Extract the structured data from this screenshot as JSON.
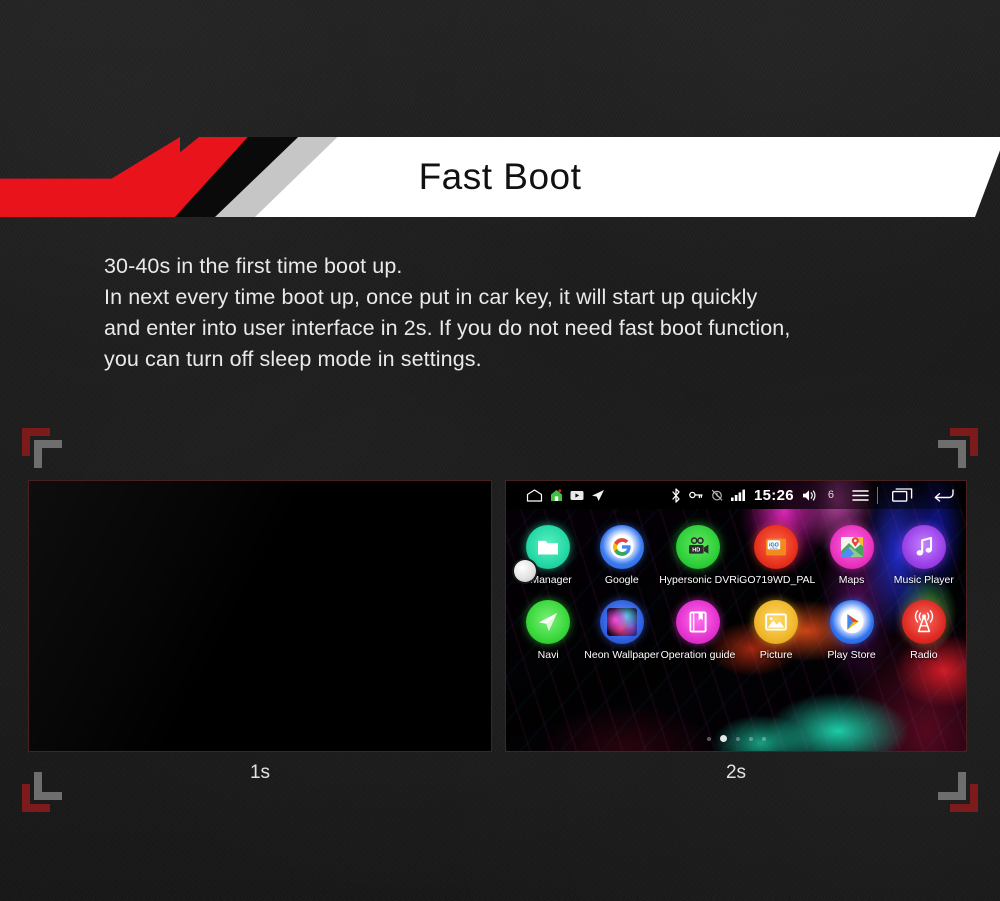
{
  "banner": {
    "title": "Fast Boot",
    "colors": {
      "red": "#e8131b",
      "black": "#0a0a0a",
      "gray": "#c6c6c6",
      "white": "#ffffff"
    }
  },
  "body_copy": {
    "line1": "30-40s in the first time boot up.",
    "line2": "In next every time boot up, once put in car key, it will start up quickly",
    "line3": "and enter into user interface in 2s. If you do not need fast boot function,",
    "line4": "you can turn off sleep mode in settings."
  },
  "screens": {
    "left": {
      "caption": "1s",
      "state": "black-screen"
    },
    "right": {
      "caption": "2s",
      "state": "android-home"
    }
  },
  "android": {
    "statusbar": {
      "left_icons": [
        "home-outline-icon",
        "green-house-icon",
        "video-icon",
        "navigation-arrow-icon"
      ],
      "right_icons": [
        "bluetooth-icon",
        "vpn-key-icon",
        "alarm-off-icon",
        "signal-bars-icon"
      ],
      "clock": "15:26",
      "volume_icon": "volume-icon",
      "notification_count": "6",
      "nav_icons": [
        "menu-icon",
        "recents-icon",
        "back-icon"
      ]
    },
    "apps": [
      {
        "label": "eManager",
        "icon": "folder-icon",
        "icon_class": "ic-emanager"
      },
      {
        "label": "Google",
        "icon": "google-g-icon",
        "icon_class": "ic-google"
      },
      {
        "label": "Hypersonic DVR",
        "icon": "video-camera-hd-icon",
        "icon_class": "ic-dvr"
      },
      {
        "label": "iGO719WD_PAL",
        "icon": "igo-primo-icon",
        "icon_class": "ic-igo"
      },
      {
        "label": "Maps",
        "icon": "google-maps-icon",
        "icon_class": "ic-maps"
      },
      {
        "label": "Music Player",
        "icon": "music-note-icon",
        "icon_class": "ic-music"
      },
      {
        "label": "Navi",
        "icon": "navigation-arrow-icon",
        "icon_class": "ic-navi"
      },
      {
        "label": "Neon Wallpaper",
        "icon": "neon-thumbnail-icon",
        "icon_class": "ic-neon"
      },
      {
        "label": "Operation guide",
        "icon": "book-icon",
        "icon_class": "ic-guide"
      },
      {
        "label": "Picture",
        "icon": "image-landscape-icon",
        "icon_class": "ic-picture"
      },
      {
        "label": "Play Store",
        "icon": "play-triangle-icon",
        "icon_class": "ic-play"
      },
      {
        "label": "Radio",
        "icon": "radio-tower-icon",
        "icon_class": "ic-radio"
      }
    ],
    "page_dots": {
      "count": 5,
      "active_index": 1
    }
  },
  "corner_markers": {
    "colors": {
      "red": "#7d1a1c",
      "gray": "#6e6e6e"
    },
    "positions": [
      "top-left",
      "top-right",
      "bottom-left",
      "bottom-right"
    ]
  }
}
